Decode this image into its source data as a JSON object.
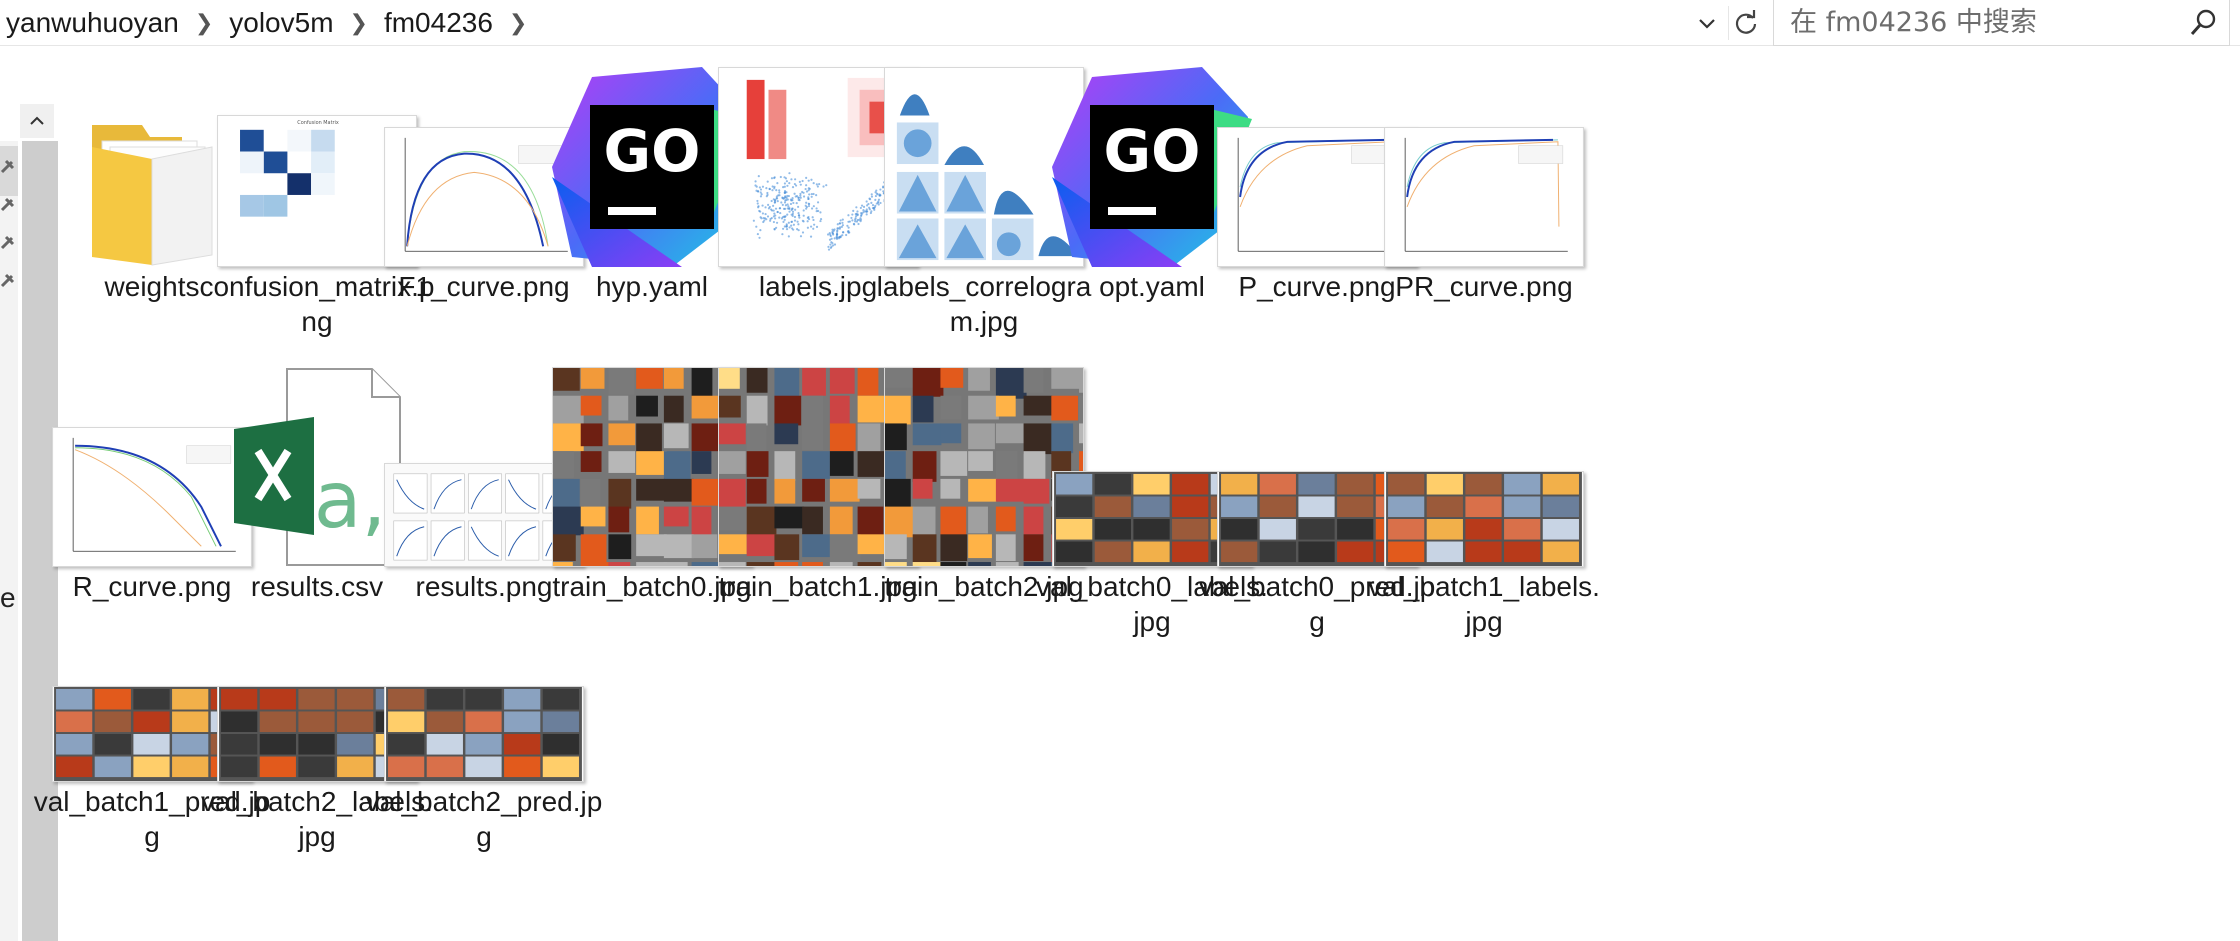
{
  "breadcrumb": [
    "yanwuhuoyan",
    "yolov5m",
    "fm04236"
  ],
  "search": {
    "placeholder": "在 fm04236 中搜索"
  },
  "nav": {
    "letter": "e"
  },
  "files": [
    {
      "name": "weights",
      "kind": "folder"
    },
    {
      "name": "confusion_matrix.png",
      "kind": "confusion"
    },
    {
      "name": "F1_curve.png",
      "kind": "curve"
    },
    {
      "name": "hyp.yaml",
      "kind": "goland"
    },
    {
      "name": "labels.jpg",
      "kind": "labels"
    },
    {
      "name": "labels_correlogram.jpg",
      "kind": "correlogram"
    },
    {
      "name": "opt.yaml",
      "kind": "goland"
    },
    {
      "name": "P_curve.png",
      "kind": "curve"
    },
    {
      "name": "PR_curve.png",
      "kind": "curve"
    },
    {
      "name": "R_curve.png",
      "kind": "curve"
    },
    {
      "name": "results.csv",
      "kind": "excel"
    },
    {
      "name": "results.png",
      "kind": "results"
    },
    {
      "name": "train_batch0.jpg",
      "kind": "mosaic"
    },
    {
      "name": "train_batch1.jpg",
      "kind": "mosaic"
    },
    {
      "name": "train_batch2.jpg",
      "kind": "mosaic"
    },
    {
      "name": "val_batch0_labels.jpg",
      "kind": "valgrid"
    },
    {
      "name": "val_batch0_pred.jpg",
      "kind": "valgrid"
    },
    {
      "name": "val_batch1_labels.jpg",
      "kind": "valgrid"
    },
    {
      "name": "val_batch1_pred.jpg",
      "kind": "valgrid"
    },
    {
      "name": "val_batch2_labels.jpg",
      "kind": "valgrid"
    },
    {
      "name": "val_batch2_pred.jpg",
      "kind": "valgrid"
    }
  ],
  "colors": {
    "folder": "#f5c842",
    "excel_green": "#1d6f42",
    "excel_letter": "#6fba8f",
    "curve_blue": "#1f3fb5",
    "fire_orange": "#e25a1c"
  },
  "icons": {
    "dropdown": "chevron-down-icon",
    "refresh": "refresh-icon",
    "search": "search-icon",
    "scroll_up": "chevron-up-icon",
    "pin": "pin-icon"
  }
}
